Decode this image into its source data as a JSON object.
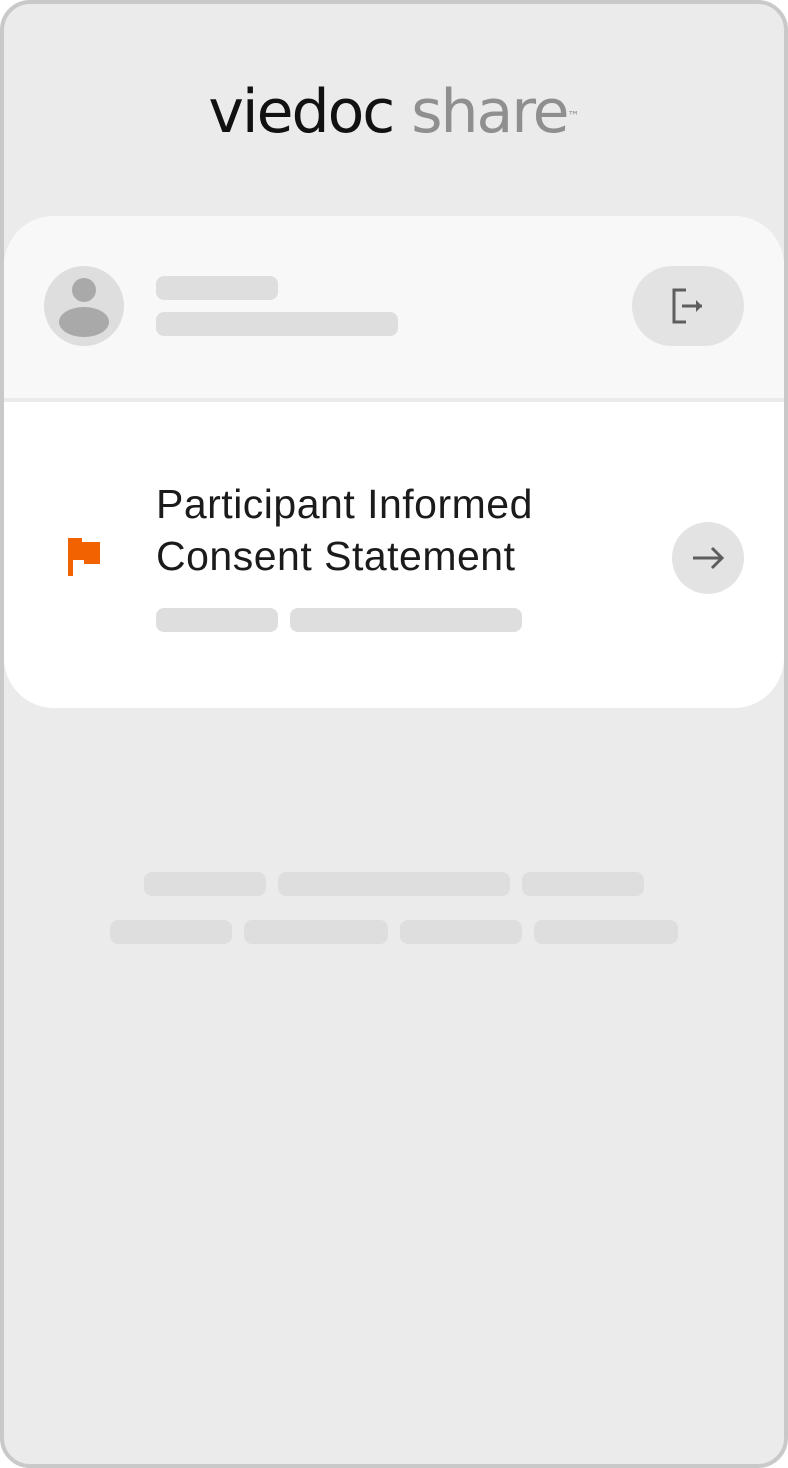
{
  "app": {
    "brand": "viedoc",
    "product": "share",
    "trademark": "™"
  },
  "document": {
    "title": "Participant Informed Consent Statement"
  },
  "icons": {
    "avatar": "user-avatar-icon",
    "logout": "logout-icon",
    "flag": "flag-icon",
    "arrow": "arrow-right-icon"
  },
  "colors": {
    "background": "#ebebeb",
    "card": "#ffffff",
    "card_header": "#f8f8f8",
    "placeholder": "#dedede",
    "flag": "#f26200",
    "brand_text": "#111111",
    "product_text": "#8f8f8f"
  }
}
